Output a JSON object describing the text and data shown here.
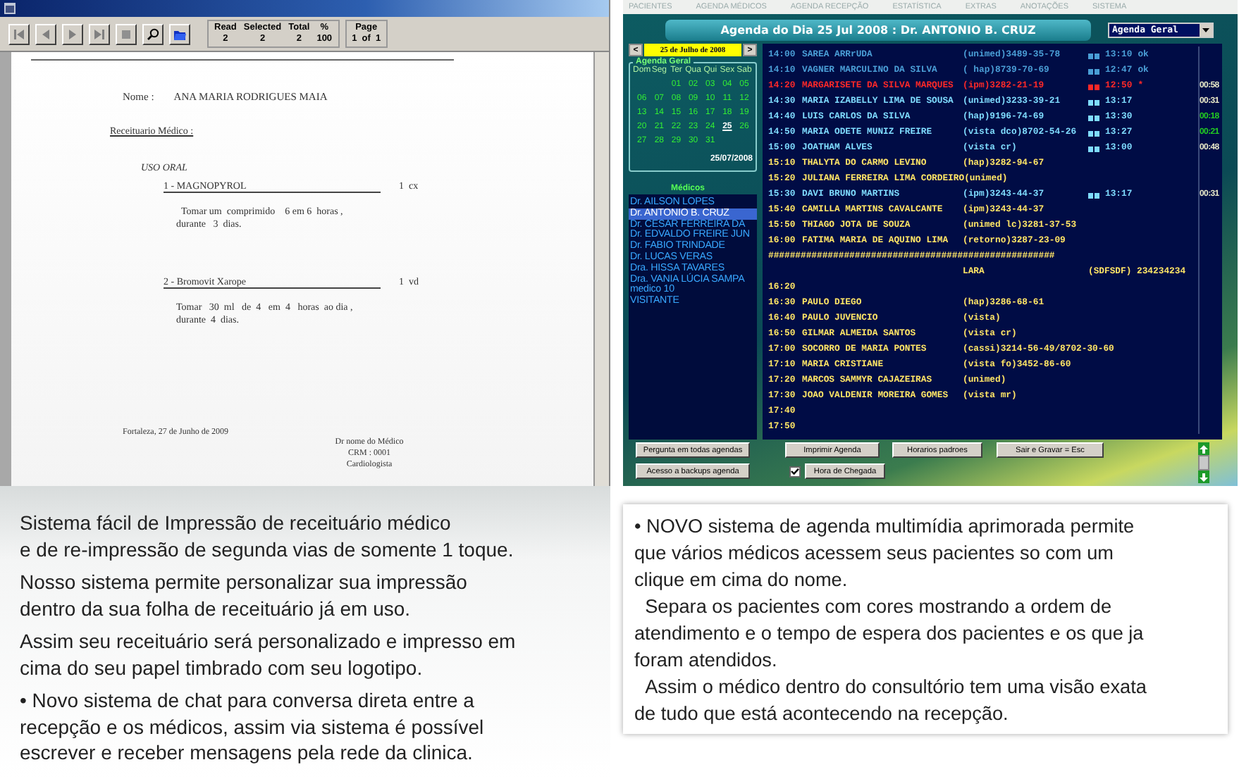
{
  "report_window": {
    "toolbar": [
      {
        "kind": "first"
      },
      {
        "kind": "prev"
      },
      {
        "kind": "next"
      },
      {
        "kind": "last"
      },
      {
        "kind": "stop"
      },
      {
        "kind": "zoom"
      },
      {
        "kind": "open"
      }
    ],
    "stats": [
      {
        "label": "Read",
        "value": "2"
      },
      {
        "label": "Selected",
        "value": "2"
      },
      {
        "label": "Total",
        "value": "2"
      },
      {
        "label": "%",
        "value": "100"
      }
    ],
    "page": {
      "label": "Page",
      "value": "1  of  1"
    },
    "document": {
      "name_label": "Nome :",
      "patient": "ANA MARIA RODRIGUES MAIA",
      "heading": "Receituario Médico :",
      "route": "USO ORAL",
      "items": [
        {
          "medicine": "1 - MAGNOPYROL",
          "quantity": "1  cx",
          "instructions": "  Tomar um  comprimido    6 em 6  horas ,\ndurante   3  dias."
        },
        {
          "medicine": "2 - Bromovit Xarope",
          "quantity": "1  vd",
          "instructions": "Tomar   30  ml   de  4   em  4   horas  ao dia ,\ndurante  4  dias."
        }
      ],
      "place_date": "Fortaleza, 27 de Junho de 2009",
      "signature": [
        "Dr nome do Médico",
        "CRM : 0001",
        "Cardiologista"
      ]
    }
  },
  "agenda_window": {
    "menu": [
      "PACIENTES",
      "AGENDA MÉDICOS",
      "AGENDA RECEPÇÃO",
      "ESTATÍSTICA",
      "EXTRAS",
      "ANOTAÇÕES",
      "SISTEMA"
    ],
    "header": "Agenda do Dia 25 Jul 2008 : Dr. ANTONIO B. CRUZ",
    "view_select": "Agenda Geral",
    "calendar": {
      "prev": "<",
      "month": "25 de Julho de 2008",
      "next": ">",
      "title": "Agenda Geral",
      "weekdays": [
        "Dom",
        "Seg",
        "Ter",
        "Qua",
        "Qui",
        "Sex",
        "Sab"
      ],
      "weeks": [
        [
          {
            "day": "01",
            "selected": false
          },
          {
            "day": "02",
            "selected": false
          },
          {
            "day": "03",
            "selected": false
          },
          {
            "day": "04",
            "selected": false
          },
          {
            "day": "05",
            "selected": false
          }
        ],
        [
          {
            "day": "06",
            "selected": false
          },
          {
            "day": "07",
            "selected": false
          },
          {
            "day": "08",
            "selected": false
          },
          {
            "day": "09",
            "selected": false
          },
          {
            "day": "10",
            "selected": false
          },
          {
            "day": "11",
            "selected": false
          },
          {
            "day": "12",
            "selected": false
          }
        ],
        [
          {
            "day": "13",
            "selected": false
          },
          {
            "day": "14",
            "selected": false
          },
          {
            "day": "15",
            "selected": false
          },
          {
            "day": "16",
            "selected": false
          },
          {
            "day": "17",
            "selected": false
          },
          {
            "day": "18",
            "selected": false
          },
          {
            "day": "19",
            "selected": false
          }
        ],
        [
          {
            "day": "20",
            "selected": false
          },
          {
            "day": "21",
            "selected": false
          },
          {
            "day": "22",
            "selected": false
          },
          {
            "day": "23",
            "selected": false
          },
          {
            "day": "24",
            "selected": false
          },
          {
            "day": "25",
            "selected": true
          },
          {
            "day": "26",
            "selected": false
          }
        ],
        [
          {
            "day": "27",
            "selected": false
          },
          {
            "day": "28",
            "selected": false
          },
          {
            "day": "29",
            "selected": false
          },
          {
            "day": "30",
            "selected": false
          },
          {
            "day": "31",
            "selected": false
          }
        ]
      ],
      "date": "25/07/2008"
    },
    "doctors": {
      "title": "Médicos",
      "items": [
        {
          "name": "Dr. AILSON LOPES",
          "selected": false
        },
        {
          "name": "Dr. ANTONIO B. CRUZ",
          "selected": true
        },
        {
          "name": "Dr. CESAR FERREIRA DA",
          "selected": false
        },
        {
          "name": "Dr. EDVALDO FREIRE JUN",
          "selected": false
        },
        {
          "name": "Dr. FABIO TRINDADE",
          "selected": false
        },
        {
          "name": "Dr. LUCAS VERAS",
          "selected": false
        },
        {
          "name": "Dra. HISSA TAVARES",
          "selected": false
        },
        {
          "name": "Dra. VANIA LÚCIA SAMPA",
          "selected": false
        },
        {
          "name": "medico 10",
          "selected": false
        },
        {
          "name": "VISITANTE",
          "selected": false
        }
      ]
    },
    "agenda": [
      {
        "kind": "slot",
        "time": "14:00",
        "patient": "SAREA ARRrUDA",
        "plan": "(unimed)3489-35-78",
        "arrival": "13:10",
        "status": "ok",
        "color": "#4a9ed6"
      },
      {
        "kind": "slot",
        "time": "14:10",
        "patient": "VAGNER MARCULINO DA SILVA",
        "plan": "( hap)8739-70-69",
        "arrival": "12:47",
        "status": "ok",
        "color": "#4a9ed6"
      },
      {
        "kind": "slot",
        "time": "14:20",
        "patient": "MARGARISETE DA SILVA MARQUES",
        "plan": "(ipm)3282-21-19",
        "arrival": "12:50",
        "status": "*",
        "color": "#ff2828",
        "wait": {
          "text": "00:58",
          "color": "#e8e8c8"
        }
      },
      {
        "kind": "slot",
        "time": "14:30",
        "patient": "MARIA IZABELLY LIMA DE SOUSA",
        "plan": "(unimed)3233-39-21",
        "arrival": "13:17",
        "color": "#7fdcff",
        "wait": {
          "text": "00:31",
          "color": "#e8e8c8"
        }
      },
      {
        "kind": "slot",
        "time": "14:40",
        "patient": "LUIS CARLOS DA SILVA",
        "plan": "(hap)9196-74-69",
        "arrival": "13:30",
        "color": "#7fdcff",
        "wait": {
          "text": "00:18",
          "color": "#22cc22"
        }
      },
      {
        "kind": "slot",
        "time": "14:50",
        "patient": "MARIA ODETE MUNIZ FREIRE",
        "plan": "(vista dco)8702-54-26",
        "arrival": "13:27",
        "color": "#7fdcff",
        "wait": {
          "text": "00:21",
          "color": "#22cc22"
        }
      },
      {
        "kind": "slot",
        "time": "15:00",
        "patient": "JOATHAM ALVES",
        "plan": "(vista cr)",
        "arrival": "13:00",
        "color": "#7fdcff",
        "wait": {
          "text": "00:48",
          "color": "#e8e8c8"
        }
      },
      {
        "kind": "slot",
        "time": "15:10",
        "patient": "THALYTA DO CARMO LEVINO",
        "plan": "(hap)3282-94-67",
        "color": "#ffe566"
      },
      {
        "kind": "slot",
        "time": "15:20",
        "patient": "JULIANA FERREIRA LIMA CORDEIRO",
        "plan": "(unimed)",
        "color": "#ffe566"
      },
      {
        "kind": "slot",
        "time": "15:30",
        "patient": "DAVI BRUNO MARTINS",
        "plan": "(ipm)3243-44-37",
        "arrival": "13:17",
        "color": "#7fdcff",
        "wait": {
          "text": "00:31",
          "color": "#e8e8c8"
        }
      },
      {
        "kind": "slot",
        "time": "15:40",
        "patient": "CAMILLA MARTINS CAVALCANTE",
        "plan": "(ipm)3243-44-37",
        "color": "#ffe566"
      },
      {
        "kind": "slot",
        "time": "15:50",
        "patient": "THIAGO JOTA DE SOUZA",
        "plan": "(unimed lc)3281-37-53",
        "color": "#ffe566"
      },
      {
        "kind": "slot",
        "time": "16:00",
        "patient": "FATIMA MARIA DE AQUINO LIMA",
        "plan": "(retorno)3287-23-09",
        "color": "#ffe566"
      },
      {
        "kind": "separator",
        "text": "#####################################################",
        "color": "#ffe566"
      },
      {
        "kind": "slot",
        "plan": "LARA",
        "note": "(SDFSDF) 234234234",
        "color": "#ffe566"
      },
      {
        "kind": "slot",
        "time": "16:20",
        "color": "#ffe566"
      },
      {
        "kind": "slot",
        "time": "16:30",
        "patient": "PAULO DIEGO",
        "plan": "(hap)3286-68-61",
        "color": "#ffe566"
      },
      {
        "kind": "slot",
        "time": "16:40",
        "patient": "PAULO JUVENCIO",
        "plan": "(vista)",
        "color": "#ffe566"
      },
      {
        "kind": "slot",
        "time": "16:50",
        "patient": "GILMAR ALMEIDA SANTOS",
        "plan": "(vista cr)",
        "color": "#ffe566"
      },
      {
        "kind": "slot",
        "time": "17:00",
        "patient": "SOCORRO DE MARIA PONTES",
        "plan": "(cassi)3214-56-49/8702-30-60",
        "color": "#ffe566"
      },
      {
        "kind": "slot",
        "time": "17:10",
        "patient": "MARIA CRISTIANE",
        "plan": "(vista fo)3452-86-60",
        "color": "#ffe566"
      },
      {
        "kind": "slot",
        "time": "17:20",
        "patient": "MARCOS SAMMYR CAJAZEIRAS",
        "plan": "(unimed)",
        "color": "#ffe566"
      },
      {
        "kind": "slot",
        "time": "17:30",
        "patient": "JOAO VALDENIR MOREIRA GOMES",
        "plan": "(vista mr)",
        "color": "#ffe566"
      },
      {
        "kind": "slot",
        "time": "17:40",
        "color": "#ffe566"
      },
      {
        "kind": "slot",
        "time": "17:50",
        "color": "#ffe566"
      }
    ],
    "buttons": [
      "Pergunta em todas agendas",
      "Imprimir Agenda",
      "Horarios padroes",
      "Sair e Gravar = Esc",
      "Acesso a backups agenda"
    ],
    "checkbox": {
      "label": "Hora de Chegada",
      "checked": true
    }
  },
  "left_caption": [
    "Sistema fácil de Impressão de receituário médico\ne de re-impressão de segunda vias de somente 1 toque.",
    "Nosso sistema permite personalizar sua impressão\ndentro da sua folha de receituário já em uso.",
    "Assim seu receituário será personalizado e impresso em\ncima do seu papel timbrado com seu logotipo.",
    "• Novo sistema de chat para conversa direta entre a\nrecepção e os médicos, assim via sistema é possível\nescrever e receber mensagens pela rede da clinica."
  ],
  "right_caption": [
    "• NOVO sistema de agenda multimídia aprimorada permite\nque vários médicos acessem seus pacientes so com um\nclique em cima do nome.",
    "  Separa os pacientes com cores mostrando a ordem de\natendimento e o tempo de espera dos pacientes e os que ja\nforam atendidos.",
    "  Assim o médico dentro do consultório tem uma visão exata\nde tudo que está acontecendo na recepção."
  ]
}
